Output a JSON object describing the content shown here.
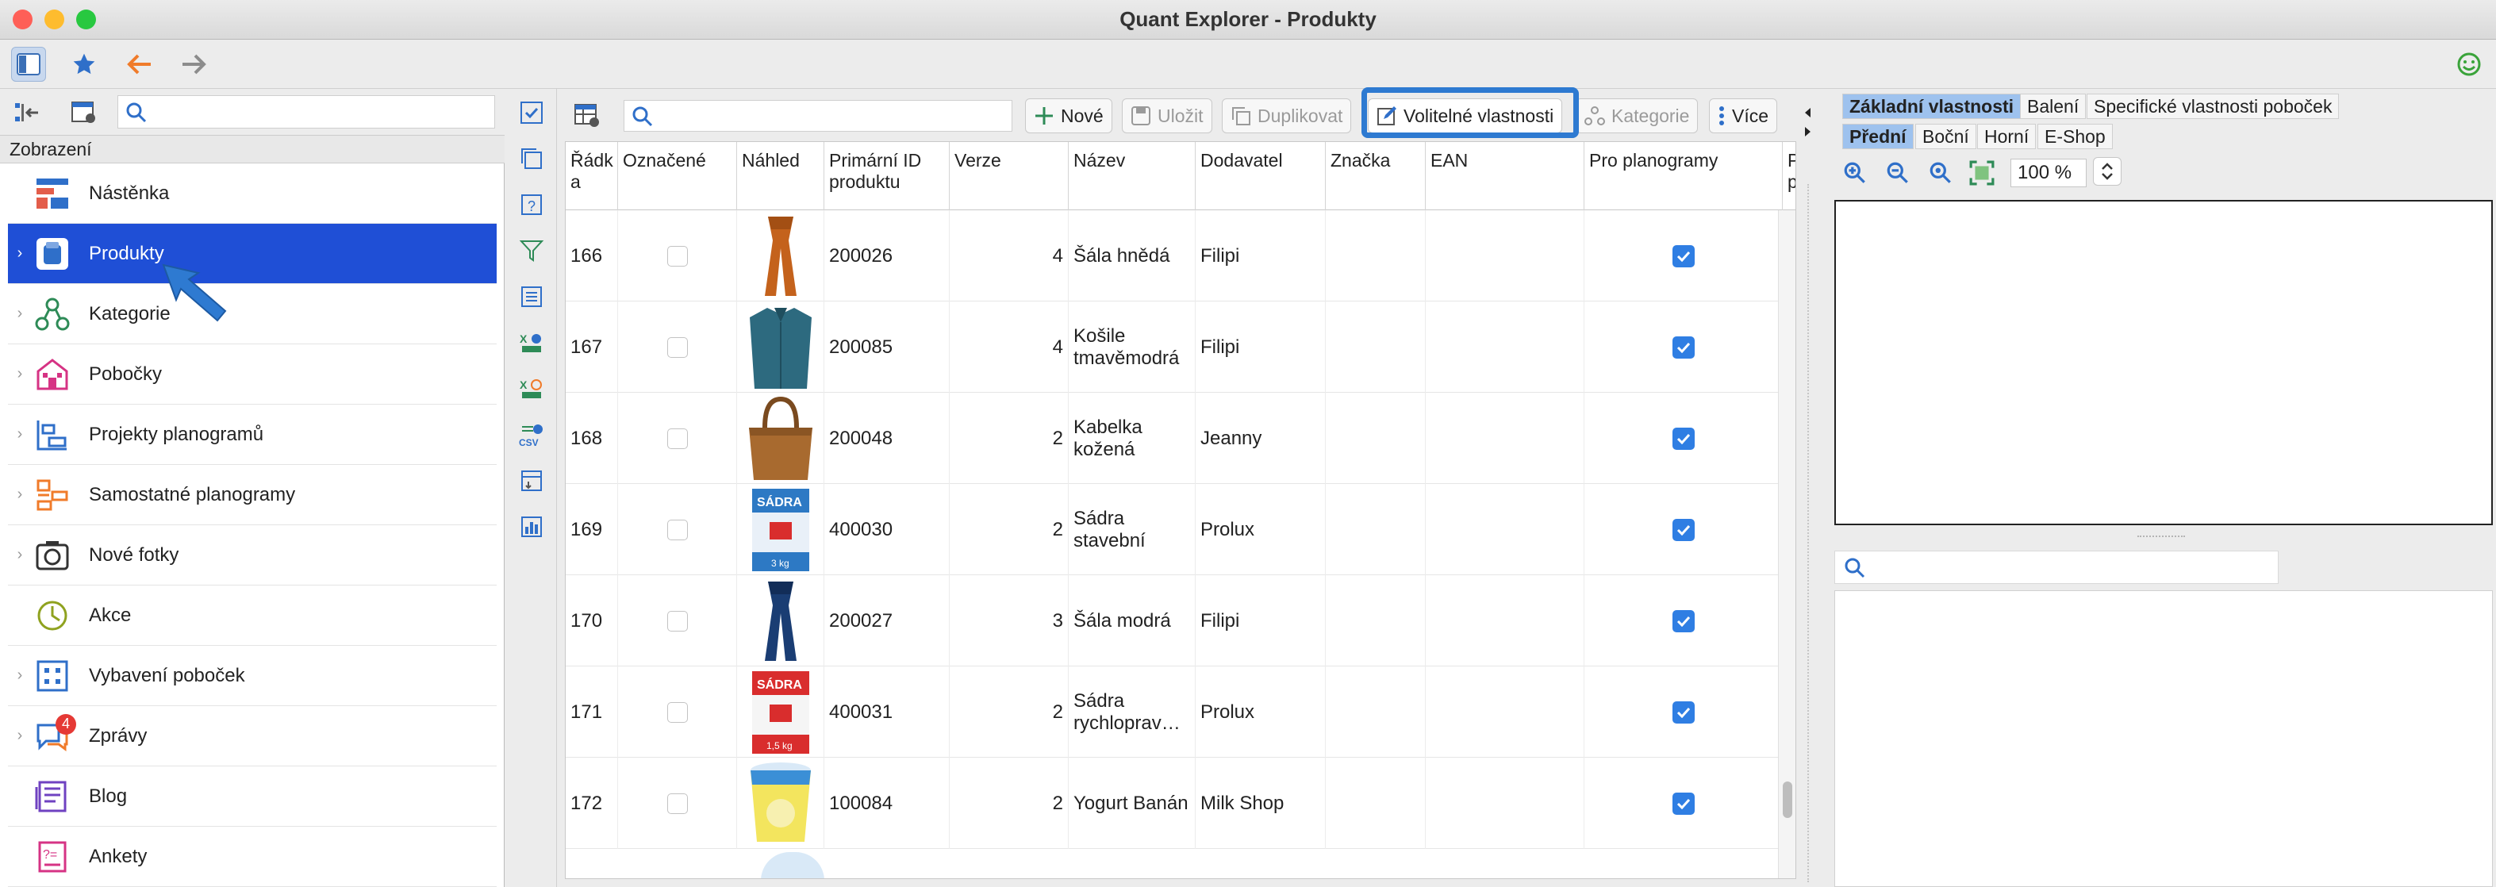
{
  "window": {
    "title": "Quant Explorer - Produkty"
  },
  "icons": {
    "toggle_sidebar": "sidebar-toggle-icon",
    "favorites": "star-icon",
    "back": "arrow-left-icon",
    "forward": "arrow-right-icon",
    "status": "smiley-icon"
  },
  "colors": {
    "selection": "#1f4fd6",
    "highlight_outline": "#2e7ad1",
    "checkbox": "#2f7ee3",
    "active_tab": "#9ec2ee"
  },
  "sidebar": {
    "section_label": "Zobrazení",
    "search_placeholder": "",
    "items": [
      {
        "label": "Nástěnka",
        "icon": "dashboard-icon",
        "expandable": false,
        "selected": false
      },
      {
        "label": "Produkty",
        "icon": "product-icon",
        "expandable": true,
        "selected": true
      },
      {
        "label": "Kategorie",
        "icon": "category-tree-icon",
        "expandable": true,
        "selected": false
      },
      {
        "label": "Pobočky",
        "icon": "store-icon",
        "expandable": true,
        "selected": false
      },
      {
        "label": "Projekty planogramů",
        "icon": "planogram-project-icon",
        "expandable": true,
        "selected": false
      },
      {
        "label": "Samostatné planogramy",
        "icon": "planogram-icon",
        "expandable": true,
        "selected": false
      },
      {
        "label": "Nové fotky",
        "icon": "camera-icon",
        "expandable": true,
        "selected": false
      },
      {
        "label": "Akce",
        "icon": "promotion-clock-icon",
        "expandable": false,
        "selected": false
      },
      {
        "label": "Vybavení poboček",
        "icon": "store-equipment-icon",
        "expandable": true,
        "selected": false
      },
      {
        "label": "Zprávy",
        "icon": "messages-icon",
        "expandable": true,
        "selected": false,
        "badge": "4"
      },
      {
        "label": "Blog",
        "icon": "blog-icon",
        "expandable": false,
        "selected": false
      },
      {
        "label": "Ankety",
        "icon": "survey-icon",
        "expandable": false,
        "selected": false
      }
    ]
  },
  "toolbar": {
    "search_placeholder": "",
    "new_label": "Nové",
    "save_label": "Uložit",
    "duplicate_label": "Duplikovat",
    "optional_props_label": "Volitelné vlastnosti",
    "category_label": "Kategorie",
    "more_label": "Více"
  },
  "table": {
    "columns": [
      "Řádk a",
      "Označené",
      "Náhled",
      "Primární ID produktu",
      "Verze",
      "Název",
      "Dodavatel",
      "Značka",
      "EAN",
      "Pro planogramy",
      "P p"
    ],
    "rows": [
      {
        "row": "166",
        "marked": false,
        "thumb": "scarf-brown",
        "id": "200026",
        "version": "4",
        "name": "Šála hnědá",
        "supplier": "Filipi",
        "brand": "",
        "ean": "",
        "planogram": true
      },
      {
        "row": "167",
        "marked": false,
        "thumb": "shirt-blue",
        "id": "200085",
        "version": "4",
        "name": "Košile tmavěmodrá",
        "supplier": "Filipi",
        "brand": "",
        "ean": "",
        "planogram": true
      },
      {
        "row": "168",
        "marked": false,
        "thumb": "handbag-leather",
        "id": "200048",
        "version": "2",
        "name": "Kabelka kožená",
        "supplier": "Jeanny",
        "brand": "",
        "ean": "",
        "planogram": true
      },
      {
        "row": "169",
        "marked": false,
        "thumb": "plaster-bag",
        "id": "400030",
        "version": "2",
        "name": "Sádra stavební",
        "supplier": "Prolux",
        "brand": "",
        "ean": "",
        "planogram": true
      },
      {
        "row": "170",
        "marked": false,
        "thumb": "scarf-blue",
        "id": "200027",
        "version": "3",
        "name": "Šála modrá",
        "supplier": "Filipi",
        "brand": "",
        "ean": "",
        "planogram": true
      },
      {
        "row": "171",
        "marked": false,
        "thumb": "plaster-bag-red",
        "id": "400031",
        "version": "2",
        "name": "Sádra rychloprav…",
        "supplier": "Prolux",
        "brand": "",
        "ean": "",
        "planogram": true
      },
      {
        "row": "172",
        "marked": false,
        "thumb": "yogurt-cup",
        "id": "100084",
        "version": "2",
        "name": "Yogurt Banán",
        "supplier": "Milk Shop",
        "brand": "",
        "ean": "",
        "planogram": true
      }
    ]
  },
  "thumbs": {
    "plaster_text": "SÁDRA",
    "plaster_weight_1": "3 kg",
    "plaster_weight_2": "1,5 kg"
  },
  "right_panel": {
    "tabs_top": [
      "Základní vlastnosti",
      "Balení",
      "Specifické vlastnosti poboček"
    ],
    "tabs_view": [
      "Přední",
      "Boční",
      "Horní",
      "E-Shop"
    ],
    "zoom": "100 %"
  }
}
